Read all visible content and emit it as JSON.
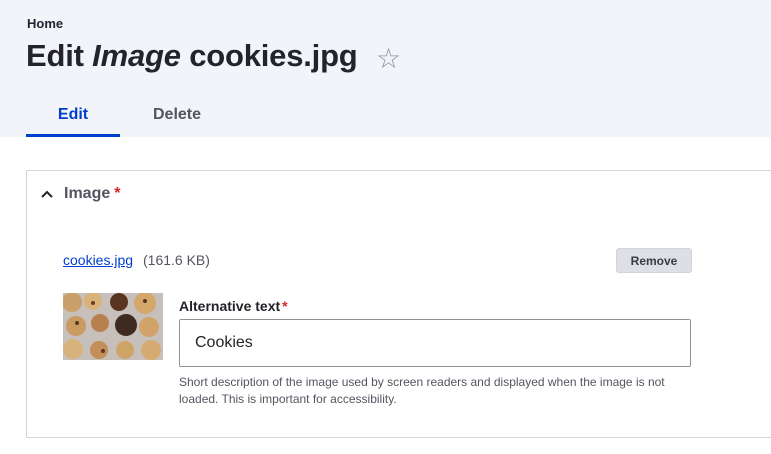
{
  "breadcrumb": "Home",
  "title": {
    "prefix": "Edit ",
    "type": "Image",
    "name": " cookies.jpg"
  },
  "star_icon": "star-outline-icon",
  "tabs": [
    {
      "label": "Edit",
      "active": true
    },
    {
      "label": "Delete",
      "active": false
    }
  ],
  "image_section": {
    "label": "Image",
    "required_marker": "*",
    "chevron_icon": "chevron-up-icon",
    "file": {
      "name": "cookies.jpg",
      "size": "(161.6 KB)"
    },
    "remove_label": "Remove",
    "alt_text": {
      "label": "Alternative text",
      "required_marker": "*",
      "value": "Cookies",
      "description": "Short description of the image used by screen readers and displayed when the image is not loaded. This is important for accessibility."
    }
  },
  "colors": {
    "accent": "#003ecc",
    "required": "#dc2323",
    "header_bg": "#f3f4f9"
  }
}
